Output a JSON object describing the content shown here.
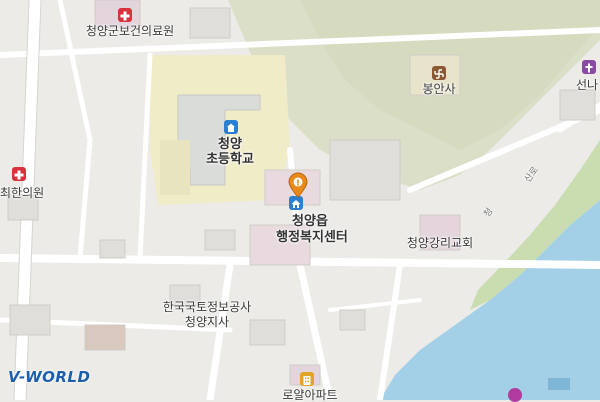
{
  "map": {
    "labels": {
      "hospital_top": "청양군보건의료원",
      "clinic_left": "최한의원",
      "school_line1": "청양",
      "school_line2": "초등학교",
      "welfare_line1": "청양읍",
      "welfare_line2": "행정복지센터",
      "temple": "봉안사",
      "church": "청양강리교회",
      "lx_line1": "한국국토정보공사",
      "lx_line2": "청양지사",
      "apartment": "로얄아파트",
      "partial_right": "선나",
      "road_1": "산로",
      "road_2": "청"
    },
    "logo": "V-WORLD",
    "colors": {
      "background": "#ecebe7",
      "mountain": "#dcdfc8",
      "river": "#a3d0e6",
      "riverbank": "#c9ddb0",
      "road": "#ffffff",
      "school_ground": "#f0ecc8",
      "hospital_red": "#d8333d",
      "school_blue": "#2b7fd0",
      "marker_orange": "#e88a1a",
      "logo_blue": "#1c5fae"
    },
    "icons": {
      "hospital": "hospital-cross-icon",
      "clinic": "hospital-cross-icon",
      "school": "school-icon",
      "welfare": "public-office-icon",
      "temple": "temple-manji-icon",
      "church": "church-icon",
      "apartment": "apartment-icon",
      "marker": "location-pin-icon"
    }
  }
}
